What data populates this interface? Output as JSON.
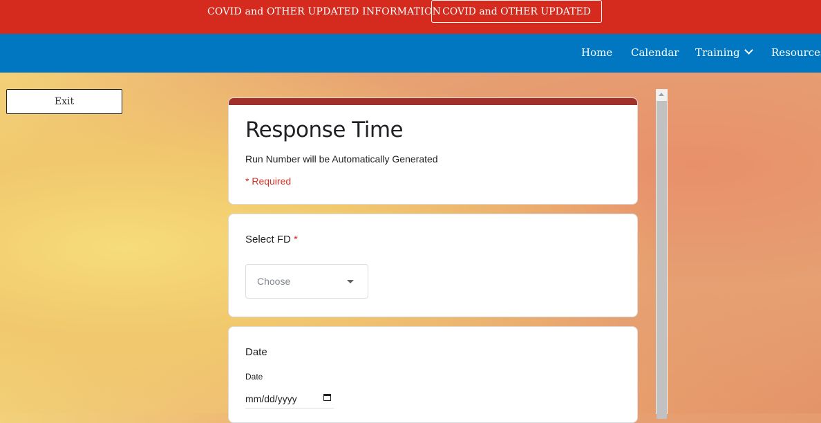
{
  "topbar": {
    "link_label": "COVID and OTHER UPDATED INFORMATION",
    "button_label": "COVID and OTHER UPDATED"
  },
  "nav": {
    "items": [
      {
        "label": "Home"
      },
      {
        "label": "Calendar"
      },
      {
        "label": "Training"
      },
      {
        "label": "Resources"
      }
    ]
  },
  "exit_label": "Exit",
  "form": {
    "title": "Response Time",
    "description": "Run Number will be Automatically Generated",
    "required_note": "* Required",
    "questions": [
      {
        "label": "Select FD",
        "required_mark": "*",
        "placeholder": "Choose"
      },
      {
        "label": "Date",
        "sub_label": "Date",
        "value": "mm/dd/yyyy"
      }
    ]
  },
  "colors": {
    "topbar": "#d52b1e",
    "navbar": "#0077c0",
    "form_accent": "#a0312a"
  }
}
